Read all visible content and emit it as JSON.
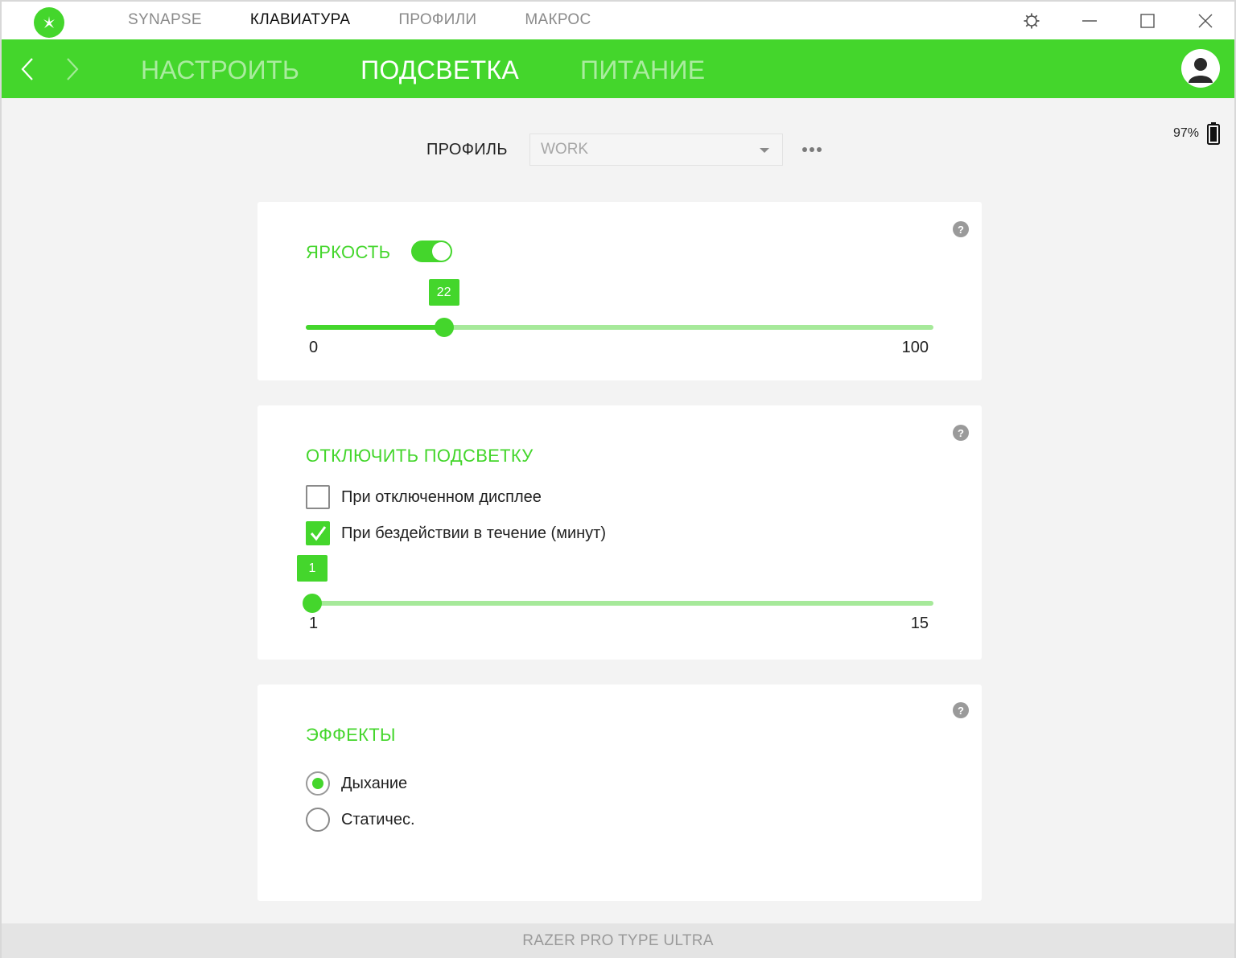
{
  "topnav": {
    "items": [
      {
        "label": "SYNAPSE",
        "active": false
      },
      {
        "label": "КЛАВИАТУРА",
        "active": true
      },
      {
        "label": "ПРОФИЛИ",
        "active": false
      },
      {
        "label": "МАКРОС",
        "active": false
      }
    ]
  },
  "subnav": {
    "tabs": [
      {
        "label": "НАСТРОИТЬ",
        "active": false
      },
      {
        "label": "ПОДСВЕТКА",
        "active": true
      },
      {
        "label": "ПИТАНИЕ",
        "active": false
      }
    ]
  },
  "battery": {
    "percent_label": "97%",
    "level": 0.97
  },
  "profile": {
    "label": "ПРОФИЛЬ",
    "selected": "WORK"
  },
  "brightness": {
    "title": "ЯРКОСТЬ",
    "enabled": true,
    "value_label": "22",
    "value": 22,
    "min_label": "0",
    "max_label": "100",
    "min": 0,
    "max": 100
  },
  "lighting_off": {
    "title": "ОТКЛЮЧИТЬ ПОДСВЕТКУ",
    "options": [
      {
        "label": "При отключенном дисплее",
        "checked": false
      },
      {
        "label": "При бездействии в течение (минут)",
        "checked": true
      }
    ],
    "idle_value_label": "1",
    "idle_value": 1,
    "min_label": "1",
    "max_label": "15",
    "min": 1,
    "max": 15
  },
  "effects": {
    "title": "ЭФФЕКТЫ",
    "options": [
      {
        "label": "Дыхание",
        "selected": true
      },
      {
        "label": "Статичес.",
        "selected": false
      }
    ]
  },
  "help_label": "?",
  "footer": {
    "device_name": "RAZER PRO TYPE ULTRA"
  },
  "colors": {
    "accent": "#44d62c",
    "accent_light": "#a6e99a"
  },
  "icons": {
    "logo": "razer-logo-icon",
    "settings": "gear-icon",
    "minimize": "minimize-icon",
    "maximize": "maximize-icon",
    "close": "close-icon",
    "back": "chevron-left-icon",
    "forward": "chevron-right-icon",
    "avatar": "user-avatar-icon",
    "battery": "battery-icon",
    "more": "more-horizontal-icon",
    "help": "help-icon"
  }
}
